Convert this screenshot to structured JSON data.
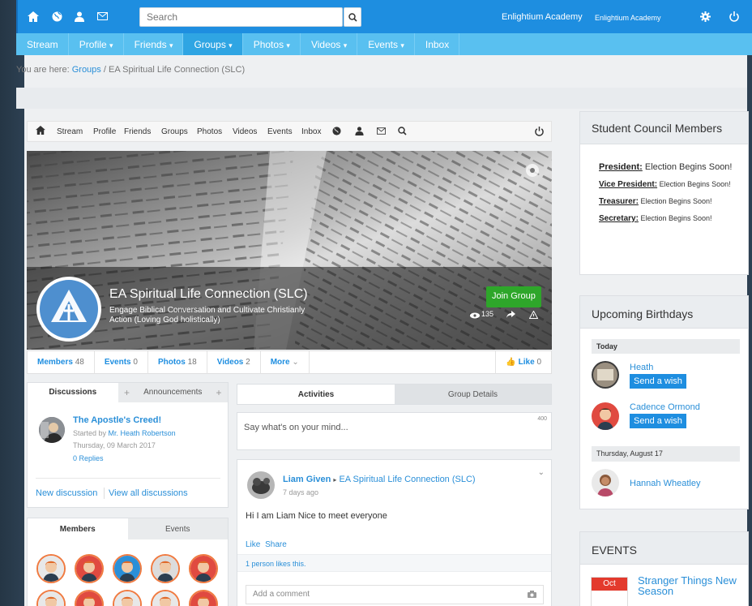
{
  "topbar": {
    "search_placeholder": "Search",
    "user_name": "Enlightium Academy",
    "user_name_small": "Enlightium Academy"
  },
  "nav": {
    "items": [
      {
        "label": "Stream",
        "caret": ""
      },
      {
        "label": "Profile",
        "caret": "▾"
      },
      {
        "label": "Friends",
        "caret": "▾"
      },
      {
        "label": "Groups",
        "caret": "▾"
      },
      {
        "label": "Photos",
        "caret": "▾"
      },
      {
        "label": "Videos",
        "caret": "▾"
      },
      {
        "label": "Events",
        "caret": "▾"
      },
      {
        "label": "Inbox",
        "caret": ""
      }
    ],
    "active": "Groups"
  },
  "breadcrumb": {
    "prefix": "You are here:",
    "link": "Groups",
    "sep": "/",
    "current": "EA Spiritual Life Connection (SLC)"
  },
  "subnav": {
    "items": [
      "Stream",
      "Profile",
      "Friends",
      "Groups",
      "Photos",
      "Videos",
      "Events",
      "Inbox"
    ]
  },
  "group": {
    "name": "EA Spiritual Life Connection (SLC)",
    "description": "Engage Biblical Conversation and Cultivate Christianly Action (Loving God holistically)",
    "join_label": "Join Group",
    "views": "135"
  },
  "group_tabs": [
    {
      "label": "Members",
      "count": "48"
    },
    {
      "label": "Events",
      "count": "0"
    },
    {
      "label": "Photos",
      "count": "18"
    },
    {
      "label": "Videos",
      "count": "2"
    }
  ],
  "more_label": "More",
  "like_label": "Like",
  "like_count": "0",
  "discussions": {
    "tab1": "Discussions",
    "tab2": "Announcements",
    "plus": "+",
    "item": {
      "title": "The Apostle's Creed!",
      "started_prefix": "Started by",
      "author": "Mr. Heath Robertson",
      "date": "Thursday, 09 March 2017",
      "replies": "0 Replies"
    },
    "new_link": "New discussion",
    "all_link": "View all discussions"
  },
  "members_tabs": {
    "tab1": "Members",
    "tab2": "Events"
  },
  "activity_tabs": {
    "tab1": "Activities",
    "tab2": "Group Details"
  },
  "composer": {
    "placeholder": "Say what's on your mind...",
    "counter": "400"
  },
  "post": {
    "author": "Liam Given",
    "arrow": "▸",
    "target": "EA Spiritual Life Connection (SLC)",
    "time": "7 days ago",
    "text": "Hi I am Liam Nice to meet everyone",
    "like": "Like",
    "share": "Share",
    "likes_text": "1 person likes this.",
    "comment_placeholder": "Add a comment"
  },
  "council": {
    "title": "Student Council Members",
    "rows": [
      {
        "role": "President:",
        "text": "Election Begins Soon!"
      },
      {
        "role": "Vice President:",
        "text": "Election Begins Soon!"
      },
      {
        "role": "Treasurer:",
        "text": "Election Begins Soon!"
      },
      {
        "role": "Secretary:",
        "text": "Election Begins Soon!"
      }
    ]
  },
  "birthdays": {
    "title": "Upcoming Birthdays",
    "today_label": "Today",
    "wish_label": "Send a wish",
    "people": [
      {
        "name": "Heath"
      },
      {
        "name": "Cadence Ormond"
      }
    ],
    "later_label": "Thursday, August 17",
    "later_person": "Hannah Wheatley"
  },
  "events": {
    "title": "EVENTS",
    "month": "Oct",
    "event_title": "Stranger Things New Season"
  },
  "colors": {
    "brand": "#1e8ee0",
    "nav": "#59c0f0",
    "join": "#2ea62a"
  }
}
